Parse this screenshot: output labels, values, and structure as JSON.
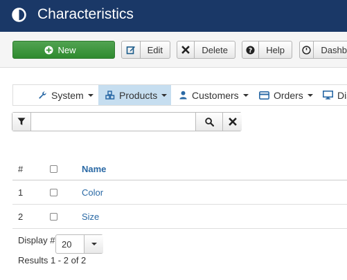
{
  "header": {
    "title": "Characteristics",
    "icon": "contrast-icon"
  },
  "toolbar": {
    "new_label": "New",
    "edit_label": "Edit",
    "delete_label": "Delete",
    "help_label": "Help",
    "dashboard_label": "Dashb"
  },
  "menu": {
    "items": [
      {
        "label": "System",
        "icon": "wrench-icon",
        "active": false
      },
      {
        "label": "Products",
        "icon": "cubes-icon",
        "active": true
      },
      {
        "label": "Customers",
        "icon": "user-icon",
        "active": false
      },
      {
        "label": "Orders",
        "icon": "credit-card-icon",
        "active": false
      },
      {
        "label": "Dis",
        "icon": "monitor-icon",
        "active": false
      }
    ]
  },
  "filter": {
    "value": "",
    "placeholder": ""
  },
  "table": {
    "headers": {
      "num": "#",
      "name": "Name"
    },
    "rows": [
      {
        "num": "1",
        "name": "Color"
      },
      {
        "num": "2",
        "name": "Size"
      }
    ]
  },
  "footer": {
    "display_label": "Display #",
    "display_value": "20",
    "results": "Results 1 - 2 of 2"
  },
  "colors": {
    "header_bg": "#1a3867",
    "new_button": "#3e9a3e",
    "active_menu": "#c6def0",
    "link": "#2a69a5"
  }
}
